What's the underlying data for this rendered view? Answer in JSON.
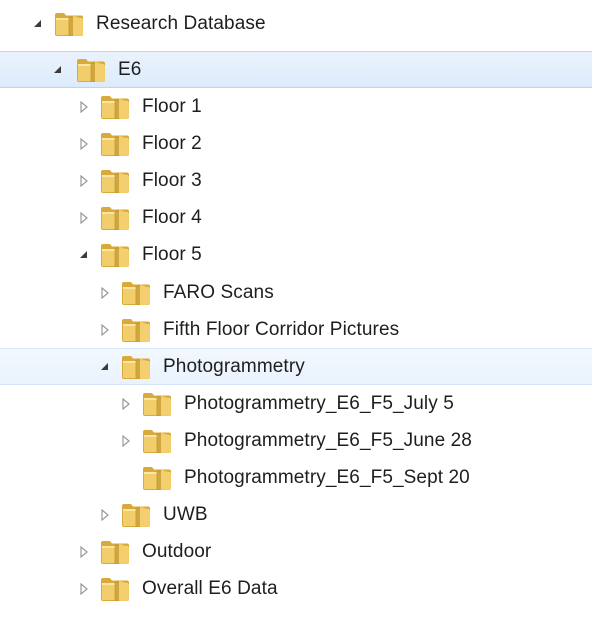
{
  "tree": {
    "root": {
      "label": "Research Database",
      "expanded": true
    },
    "e6": {
      "label": "E6",
      "expanded": true,
      "selected": true
    },
    "floors": [
      {
        "label": "Floor 1",
        "expanded": false
      },
      {
        "label": "Floor 2",
        "expanded": false
      },
      {
        "label": "Floor 3",
        "expanded": false
      },
      {
        "label": "Floor 4",
        "expanded": false
      },
      {
        "label": "Floor 5",
        "expanded": true
      }
    ],
    "floor5_children": [
      {
        "label": "FARO Scans",
        "expanded": false
      },
      {
        "label": "Fifth Floor Corridor Pictures",
        "expanded": false
      },
      {
        "label": "Photogrammetry",
        "expanded": true,
        "hovered": true
      }
    ],
    "photogrammetry_children": [
      {
        "label": "Photogrammetry_E6_F5_July 5",
        "expanded": false
      },
      {
        "label": "Photogrammetry_E6_F5_June 28",
        "expanded": false
      },
      {
        "label": "Photogrammetry_E6_F5_Sept 20",
        "has_children": false
      }
    ],
    "uwb": {
      "label": "UWB",
      "expanded": false
    },
    "outdoor": {
      "label": "Outdoor",
      "expanded": false
    },
    "overall": {
      "label": "Overall E6 Data",
      "expanded": false
    }
  },
  "colors": {
    "selection_border": "#b8d6fb",
    "selection_fill": "#dcebfc",
    "hover_fill": "#e9f2fd",
    "folder_main": "#f2cd6b",
    "folder_dark": "#d9a93a",
    "folder_light": "#fbe6a6",
    "text": "#1e1e1e"
  },
  "icons": {
    "expanded": "triangle-down-icon",
    "collapsed": "triangle-right-icon",
    "folder": "folder-icon"
  }
}
